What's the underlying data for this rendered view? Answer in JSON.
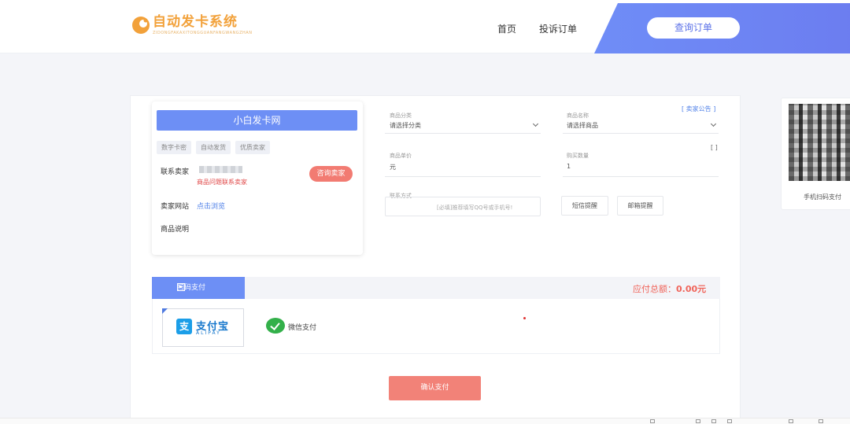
{
  "header": {
    "logo_text": "自动发卡系统",
    "logo_sub": "ZIDONGFAKAXITONGGUANFANGWANGZHAN",
    "nav": [
      {
        "label": "首页"
      },
      {
        "label": "投诉订单"
      }
    ],
    "query_button": "查询订单"
  },
  "seller": {
    "title": "小白发卡网",
    "tags": [
      "数字卡密",
      "自动发货",
      "优质卖家"
    ],
    "contact_label": "联系卖家",
    "contact_note": "商品问题联系卖家",
    "contact_button": "咨询卖家",
    "site_label": "卖家网站",
    "site_link": "点击浏览",
    "desc_label": "商品说明"
  },
  "form": {
    "category_label": "商品分类",
    "category_value": "请选择分类",
    "product_label": "商品名称",
    "product_value": "请选择商品",
    "notice_link": "[ 卖家公告 ]",
    "price_label": "商品单价",
    "price_value": "元",
    "qty_label": "购买数量",
    "qty_value": "1",
    "qty_help": "[ ]",
    "contact_label": "联系方式",
    "contact_placeholder": "[必填]推荐填写QQ号或手机号!",
    "sms_remind": "短信提醒",
    "email_remind": "邮箱提醒"
  },
  "payment": {
    "tab_label": "扫码支付",
    "total_label": "应付总额：",
    "total_value": "0.00元",
    "alipay_name": "支付宝",
    "alipay_sub": "ALIPAY",
    "alipay_mark": "支",
    "wechat_label": "微信支付",
    "confirm_button": "确认支付"
  },
  "qr_card": {
    "caption": "手机扫码支付"
  },
  "colors": {
    "accent": "#6d8ff5",
    "danger": "#f0645a",
    "logo": "#f2a13a"
  }
}
